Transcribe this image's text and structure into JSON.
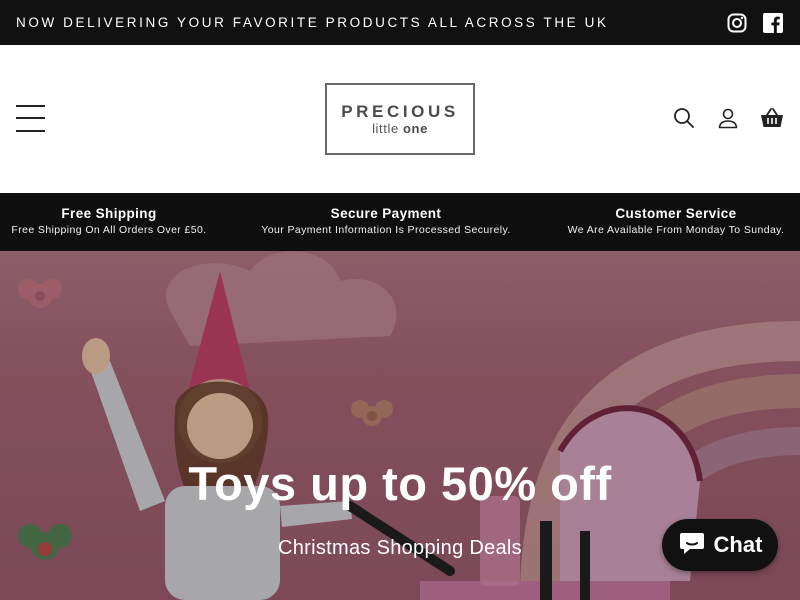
{
  "announcement": {
    "text": "NOW DELIVERING YOUR FAVORITE PRODUCTS ALL ACROSS THE UK",
    "social_icons": [
      "instagram-icon",
      "facebook-icon"
    ]
  },
  "header": {
    "logo": {
      "main": "PRECIOUS",
      "sub_light": "little",
      "sub_bold": "one"
    },
    "icons": [
      "menu-icon",
      "search-icon",
      "account-icon",
      "cart-icon"
    ]
  },
  "features": [
    {
      "title": "Free Shipping",
      "desc": "Free Shipping On All Orders Over £50."
    },
    {
      "title": "Secure Payment",
      "desc": "Your Payment Information Is Processed Securely."
    },
    {
      "title": "Customer Service",
      "desc": "We Are Available From Monday To Sunday."
    }
  ],
  "hero": {
    "title": "Toys up to 50% off",
    "subtitle": "Christmas Shopping Deals"
  },
  "chat": {
    "label": "Chat"
  },
  "colors": {
    "bar_bg": "#111111",
    "hero_pink": "#a96778",
    "text_white": "#ffffff"
  }
}
